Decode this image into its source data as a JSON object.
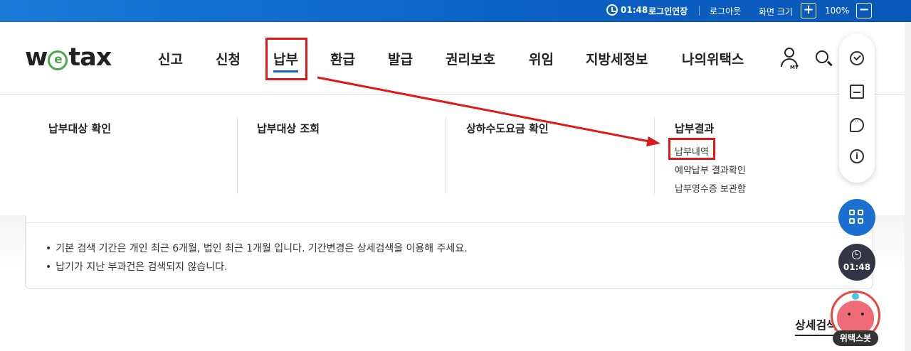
{
  "topbar": {
    "time": "01:48",
    "extend_login": "로그인연장",
    "logout": "로그아웃",
    "zoom_label": "화면 크기",
    "zoom_in": "+",
    "zoom_value": "100%",
    "zoom_out": "−"
  },
  "logo": {
    "pre": "w",
    "e": "e",
    "post": "tax"
  },
  "nav": [
    "신고",
    "신청",
    "납부",
    "환급",
    "발급",
    "권리보호",
    "위임",
    "지방세정보",
    "나의위택스"
  ],
  "my_label": "MY",
  "mega_menu": {
    "columns": [
      "납부대상 확인",
      "납부대상 조회",
      "상하수도요금 확인",
      "납부결과"
    ],
    "sub_items": [
      "납부내역",
      "예약납부 결과확인",
      "납부영수증 보관함"
    ]
  },
  "notice": [
    "기본 검색 기간은 개인 최근 6개월, 법인 최근 1개월 입니다. 기간변경은 상세검색을 이용해 주세요.",
    "납기가 지난 부과건은 검색되지 않습니다."
  ],
  "detail_search": "상세검색",
  "quick_menu": {
    "info_glyph": "i"
  },
  "timer": "01:48",
  "chatbot": "위택스봇",
  "annotation_color": "#e01818",
  "accent_color": "#1565c0"
}
